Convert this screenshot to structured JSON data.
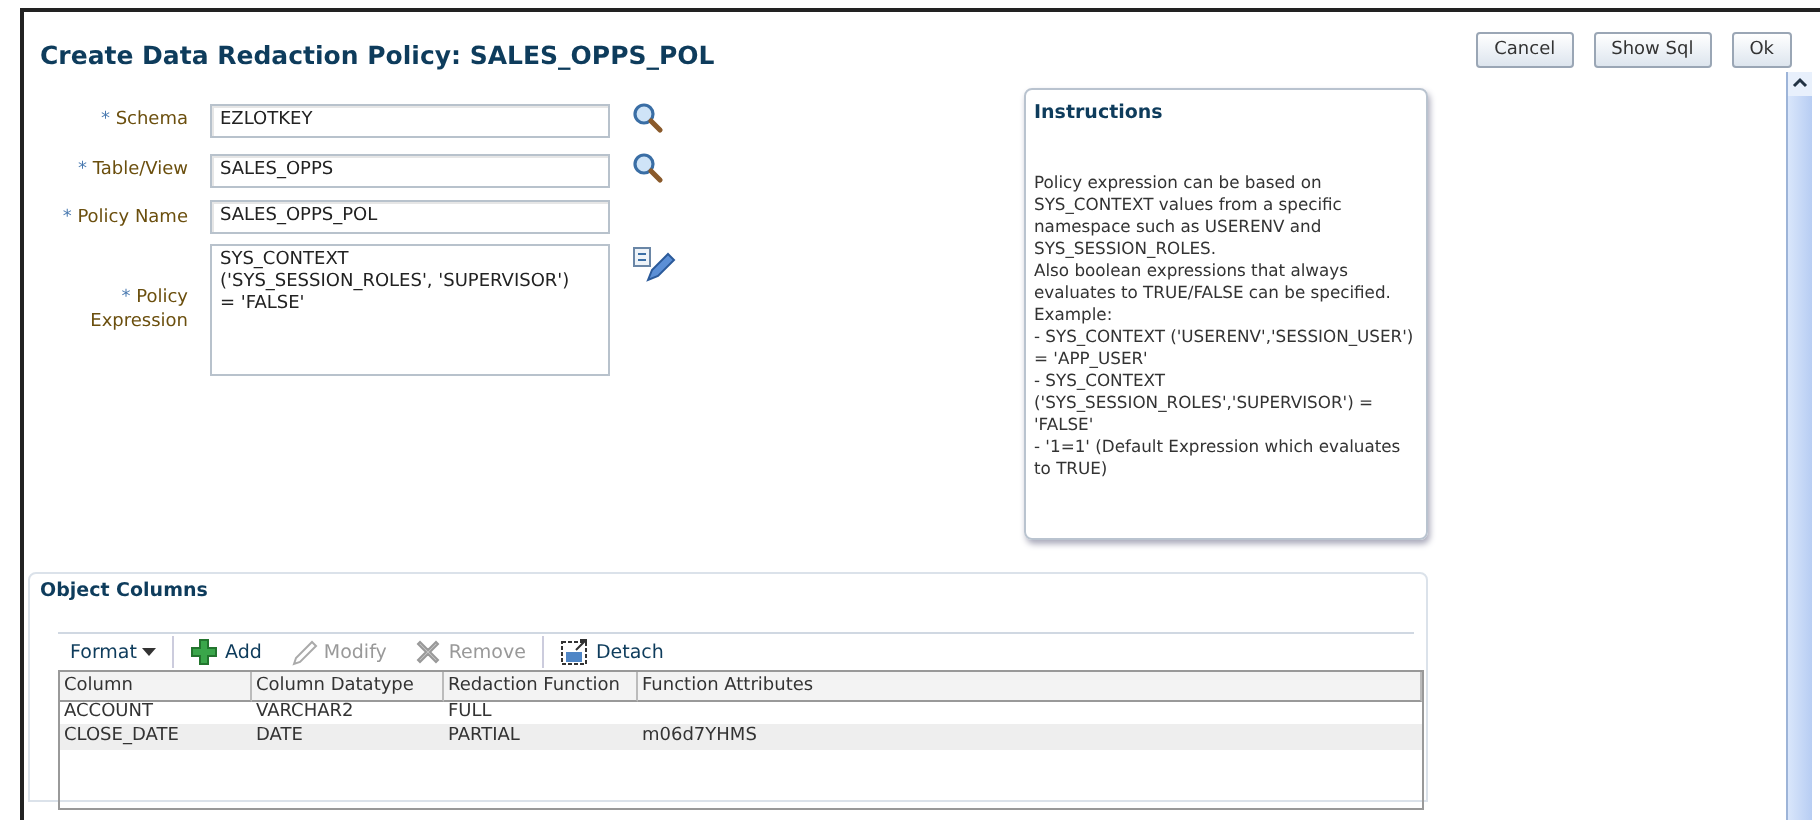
{
  "title": "Create Data Redaction Policy: SALES_OPPS_POL",
  "buttons": [
    {
      "label": "Cancel"
    },
    {
      "label": "Show Sql"
    },
    {
      "label": "Ok"
    }
  ],
  "form": [
    {
      "label": "Schema",
      "required_mark": "*",
      "value": "EZLOTKEY",
      "kind": "lookup"
    },
    {
      "label": "Table/View",
      "required_mark": "*",
      "value": "SALES_OPPS",
      "kind": "lookup"
    },
    {
      "label": "Policy Name",
      "required_mark": "*",
      "value": "SALES_OPPS_POL",
      "kind": "text"
    },
    {
      "label": "Policy Expression",
      "required_mark": "*",
      "value": "SYS_CONTEXT\n('SYS_SESSION_ROLES', 'SUPERVISOR')\n= 'FALSE'",
      "kind": "expression"
    }
  ],
  "instructions": {
    "title": "Instructions",
    "lines": [
      "Policy expression can be based on SYS_CONTEXT values from a specific namespace such as USERENV and SYS_SESSION_ROLES.",
      "Also boolean expressions that always evaluates to TRUE/FALSE can be specified.",
      "Example:",
      "- SYS_CONTEXT ('USERENV','SESSION_USER') = 'APP_USER'",
      "- SYS_CONTEXT ('SYS_SESSION_ROLES','SUPERVISOR') = 'FALSE'",
      "- '1=1' (Default Expression which evaluates to TRUE)"
    ]
  },
  "object_columns": {
    "title": "Object Columns",
    "toolbar": [
      {
        "label": "Format",
        "kind": "menu",
        "disabled": false
      },
      {
        "label": "Add",
        "kind": "add",
        "disabled": false
      },
      {
        "label": "Modify",
        "kind": "modify",
        "disabled": true
      },
      {
        "label": "Remove",
        "kind": "remove",
        "disabled": true
      },
      {
        "label": "Detach",
        "kind": "detach",
        "disabled": false
      }
    ],
    "columns": [
      "Column",
      "Column Datatype",
      "Redaction Function",
      "Function Attributes"
    ],
    "rows": [
      [
        "ACCOUNT",
        "VARCHAR2",
        "FULL",
        ""
      ],
      [
        "CLOSE_DATE",
        "DATE",
        "PARTIAL",
        "m06d7YHMS"
      ]
    ]
  }
}
